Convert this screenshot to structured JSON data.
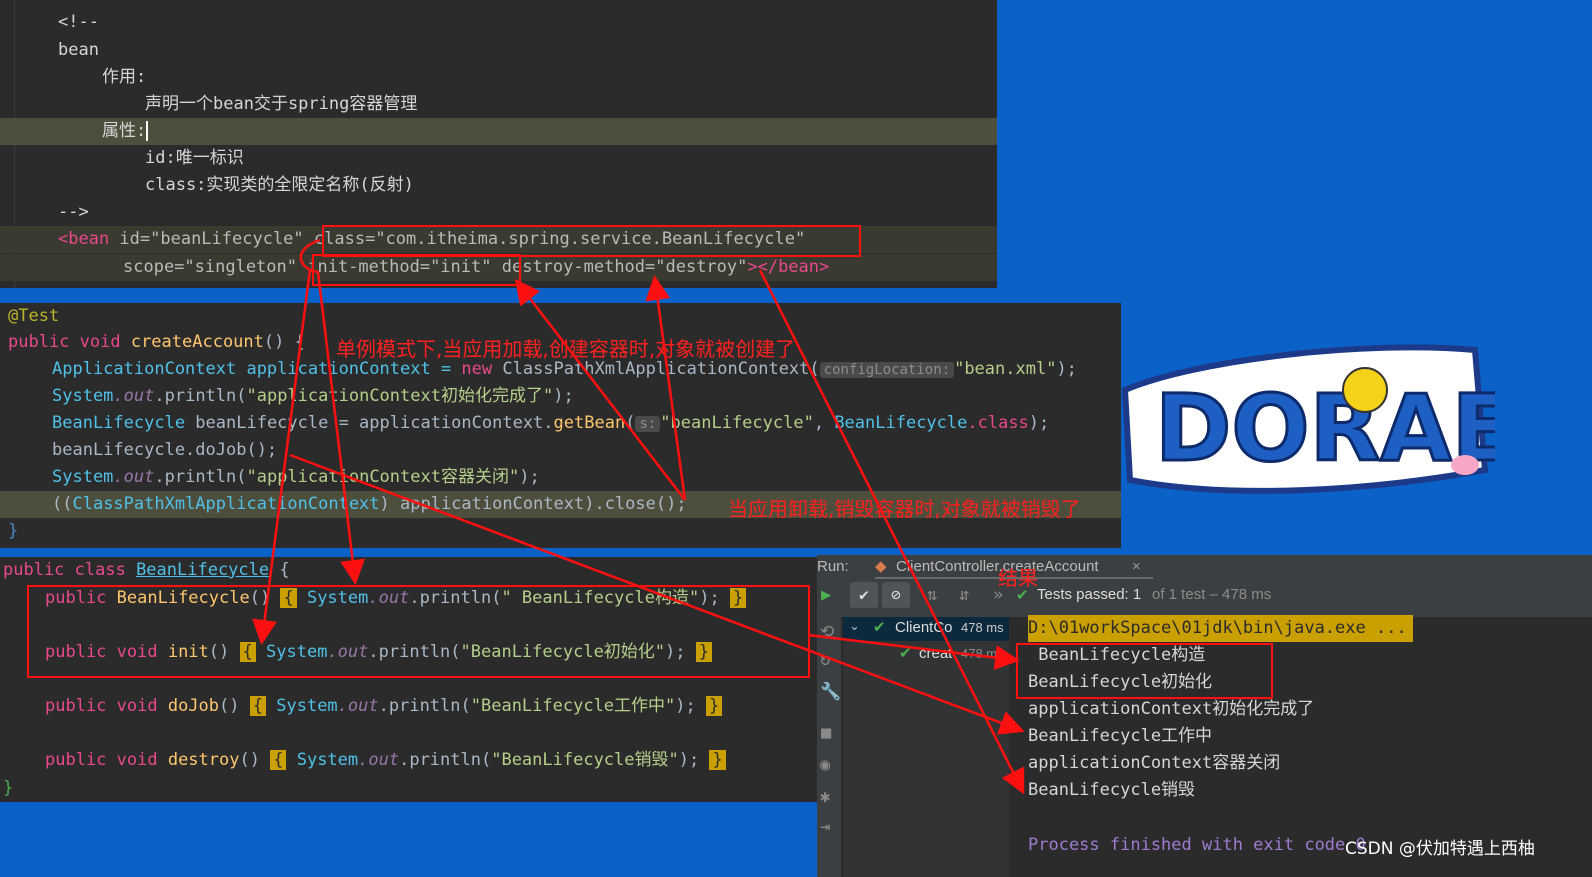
{
  "xml_panel": {
    "lines": [
      "<!--",
      "bean",
      "作用:",
      "声明一个bean交于spring容器管理",
      "属性:",
      "id:唯一标识",
      "class:实现类的全限定名称(反射)",
      "-->"
    ],
    "bean_tag": "<bean",
    "id_attr": " id=\"beanLifecycle\"",
    "class_attr": "class=\"com.itheima.spring.service.BeanLifecycle\"",
    "scope_attr": "scope=\"singleton\"",
    "init_attr": "init-method=\"init\"",
    "destroy_attr": "destroy-method=\"destroy\"",
    "end_tag": "></bean>"
  },
  "test_panel": {
    "annotation": "@Test",
    "signature_kw": "public void ",
    "signature_name": "createAccount",
    "signature_rest": "() {",
    "line1_a": "ApplicationContext applicationContext = ",
    "line1_new": "new ",
    "line1_b": "ClassPathXmlApplicationContext(",
    "line1_hint": "configLocation:",
    "line1_str": "\"bean.xml\"",
    "line1_end": ");",
    "line2_cls": "System",
    "line2_fld": ".out",
    "line2_a": ".println(",
    "line2_str": "\"applicationContext初始化完成了\"",
    "line2_end": ");",
    "line3_a": "BeanLifecycle",
    "line3_b": " beanLifecycle = applicationContext.",
    "line3_m": "getBean",
    "line3_hint": "s:",
    "line3_str": "\"beanLifecycle\"",
    "line3_c": ", ",
    "line3_cls": "BeanLifecycle",
    "line3_kw": ".class",
    "line3_end": ");",
    "line4": "beanLifecycle.doJob();",
    "line5_str": "\"applicationContext容器关闭\"",
    "line6_a": "((",
    "line6_cls": "ClassPathXmlApplicationContext",
    "line6_b": ") applicationContext).close();",
    "closing": "}"
  },
  "class_panel": {
    "header_kw": "public class ",
    "header_name": "BeanLifecycle",
    "header_end": " {",
    "constructor_kw": "public ",
    "constructor_name": "BeanLifecycle",
    "constructor_str": "\" BeanLifecycle构造\"",
    "init_kw": "public void ",
    "init_name": "init",
    "init_str": "\"BeanLifecycle初始化\"",
    "dojob_name": "doJob",
    "dojob_str": "\"BeanLifecycle工作中\"",
    "destroy_name": "destroy",
    "destroy_str": "\"BeanLifecycle销毁\"",
    "parens": "()",
    "open_brace": "{",
    "close_brace": "}",
    "sys": "System",
    "out": ".out",
    "println": ".println(",
    "stmt_end": ");",
    "closing": "}"
  },
  "annotations": {
    "singleton_note": "单例模式下,当应用加载,创建容器时,对象就被创建了",
    "destroy_note": "当应用卸载,销毁容器时,对象就被销毁了",
    "result_label": "结果"
  },
  "run_panel": {
    "run_label": "Run:",
    "tab_label": "ClientController.createAccount",
    "tests_passed": "Tests passed: 1",
    "tests_detail": "of 1 test – 478 ms",
    "tree_root": "ClientCo",
    "tree_root_time": "478 ms",
    "tree_child": "creat",
    "tree_child_time": "478 ms",
    "output": [
      "D:\\01workSpace\\01jdk\\bin\\java.exe ...",
      " BeanLifecycle构造",
      "BeanLifecycle初始化",
      "applicationContext初始化完成了",
      "BeanLifecycle工作中",
      "applicationContext容器关闭",
      "BeanLifecycle销毁",
      "",
      "Process finished with exit code 0"
    ]
  },
  "logo_text": "DORAEMON!",
  "watermark": "CSDN @伏加特遇上西柚",
  "colors": {
    "accent_red": "#ff1010",
    "background_blue": "#0a62c8",
    "pass_green": "#3fb950"
  }
}
